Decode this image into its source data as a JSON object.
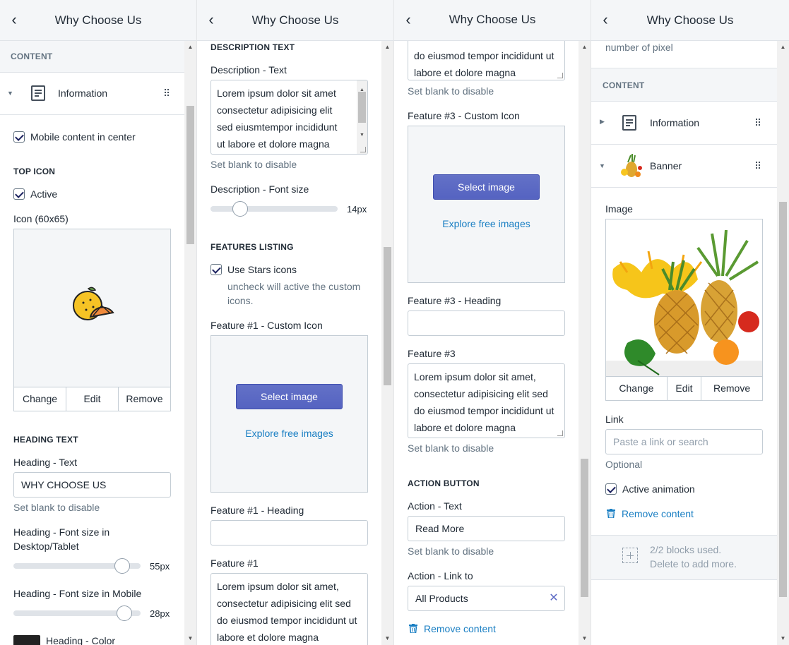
{
  "header_title": "Why Choose Us",
  "p1": {
    "content_section": "CONTENT",
    "block_label": "Information",
    "mobile_center": "Mobile content in center",
    "top_icon_section": "TOP ICON",
    "active": "Active",
    "icon_label": "Icon (60x65)",
    "change": "Change",
    "edit": "Edit",
    "remove": "Remove",
    "heading_section": "HEADING TEXT",
    "heading_text_label": "Heading - Text",
    "heading_text_value": "WHY CHOOSE US",
    "set_blank": "Set blank to disable",
    "font_desktop_label_1": "Heading - Font size in",
    "font_desktop_label_2": "Desktop/Tablet",
    "font_desktop_value": "55px",
    "font_mobile_label": "Heading - Font size in Mobile",
    "font_mobile_value": "28px",
    "heading_color_label": "Heading - Color",
    "heading_color": "#222222"
  },
  "p2": {
    "desc_section": "DESCRIPTION TEXT",
    "desc_label": "Description - Text",
    "desc_lines": [
      "Lorem ipsum dolor sit amet",
      "consectetur adipisicing elit",
      "sed eiusmtempor incididunt",
      "ut labore et dolore magna"
    ],
    "set_blank": "Set blank to disable",
    "desc_font_label": "Description - Font size",
    "desc_font_value": "14px",
    "features_section": "FEATURES LISTING",
    "use_stars": "Use Stars icons",
    "use_stars_help_1": "uncheck will active the custom",
    "use_stars_help_2": "icons.",
    "feat1_icon_label": "Feature #1 - Custom Icon",
    "select_image": "Select image",
    "explore": "Explore free images",
    "feat1_heading_label": "Feature #1 - Heading",
    "feat1_label": "Feature #1",
    "feat1_lines": [
      "Lorem ipsum dolor sit amet,",
      "consectetur adipisicing elit sed",
      "do eiusmod tempor incididunt ut",
      "labore et dolore magna"
    ]
  },
  "p3": {
    "top_lines": [
      "do eiusmod tempor incididunt ut",
      "labore et dolore magna"
    ],
    "set_blank": "Set blank to disable",
    "feat3_icon_label": "Feature #3 - Custom Icon",
    "select_image": "Select image",
    "explore": "Explore free images",
    "feat3_heading_label": "Feature #3 - Heading",
    "feat3_label": "Feature #3",
    "feat3_lines": [
      "Lorem ipsum dolor sit amet,",
      "consectetur adipisicing elit sed",
      "do eiusmod tempor incididunt ut",
      "labore et dolore magna"
    ],
    "action_section": "ACTION BUTTON",
    "action_text_label": "Action - Text",
    "action_text_value": "Read More",
    "action_link_label": "Action - Link to",
    "action_link_value": "All Products",
    "remove_content": "Remove content"
  },
  "p4": {
    "top_help": "number of pixel",
    "content_section": "CONTENT",
    "block1": "Information",
    "block2": "Banner",
    "image_label": "Image",
    "change": "Change",
    "edit": "Edit",
    "remove": "Remove",
    "link_label": "Link",
    "link_placeholder": "Paste a link or search",
    "optional": "Optional",
    "active_animation": "Active animation",
    "remove_content": "Remove content",
    "blocks_used": "2/2 blocks used.",
    "delete_more": "Delete to add more."
  }
}
